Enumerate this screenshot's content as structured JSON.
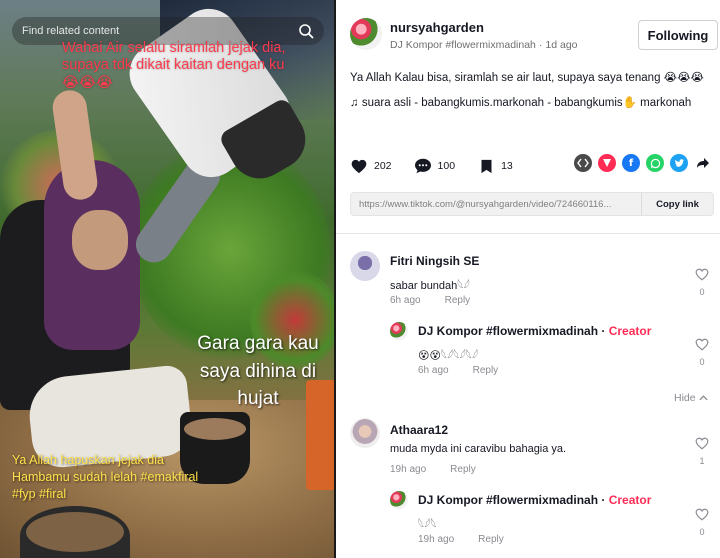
{
  "video": {
    "search_placeholder": "Find related content",
    "caption_top": "Wahai Air selalu siramlah jejak dia, supaya tdk dikait kaitan dengan ku 😭😭😭",
    "caption_middle": "Gara gara kau saya dihina di hujat",
    "caption_bottom": "Ya Allah hapuskan jejak dia Hambamu sudah lelah #emakfiral #fyp #firal"
  },
  "post": {
    "author_name": "nursyahgarden",
    "author_display": "DJ Kompor #flowermixmadinah",
    "posted": "1d ago",
    "follow_label": "Following",
    "description": "Ya Allah Kalau bisa, siramlah se air laut, supaya saya tenang 😭😭😭",
    "music": "♫  suara asli - babangkumis.markonah - babangkumis✋ markonah",
    "likes": "202",
    "comments": "100",
    "saves": "13",
    "url": "https://www.tiktok.com/@nursyahgarden/video/724660116...",
    "copy_label": "Copy link"
  },
  "comments": [
    {
      "name": "Fitri Ningsih SE",
      "text": "sabar bundah𓆩𓆪",
      "time": "6h ago",
      "reply_label": "Reply",
      "likes": "0"
    },
    {
      "name": "DJ Kompor #flowermixmadinah",
      "badge": "Creator",
      "text": "😵😵𓆩𓆪𓆩𓆪𓆩𓆪",
      "time": "6h ago",
      "reply_label": "Reply",
      "likes": "0"
    },
    {
      "hide_label": "Hide",
      "name": "Athaara12",
      "text": "muda myda ini caravibu bahagia ya.",
      "time": "19h ago",
      "reply_label": "Reply",
      "likes": "1"
    },
    {
      "name": "DJ Kompor #flowermixmadinah",
      "badge": "Creator",
      "text": "𓆩𓆪𓆩",
      "time": "19h ago",
      "reply_label": "Reply",
      "likes": "0"
    }
  ],
  "colors": {
    "accent": "#fe2c55",
    "share_embed": "#4a4a4a",
    "share_pink": "#fe2c55",
    "share_facebook": "#1877f2",
    "share_whatsapp": "#25d366",
    "share_twitter": "#1da1f2"
  },
  "icons": {
    "search": "search-icon",
    "like": "heart-icon",
    "comment": "comment-icon",
    "save": "bookmark-icon",
    "music": "music-note-icon",
    "hide": "chevron-up-icon"
  }
}
